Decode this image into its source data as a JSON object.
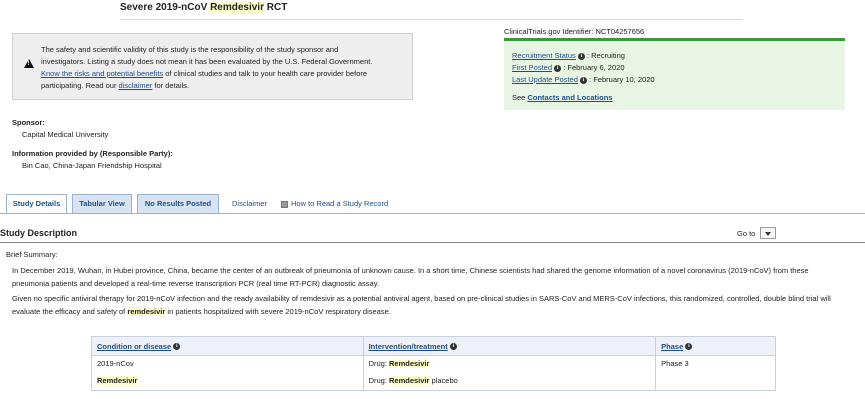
{
  "header": {
    "title_prefix": "Severe 2019-nCoV ",
    "title_highlight": "Remdesivir",
    "title_suffix": " RCT"
  },
  "disclaimer_box": {
    "line1": "The safety and scientific validity of this study is the responsibility of the study sponsor and",
    "line2": "investigators. Listing a study does not mean it has been evaluated by the U.S. Federal Government.",
    "link_risks": "Know the risks and potential benefits",
    "line3_suffix": " of clinical studies and talk to your health care provider before",
    "line4_prefix": "participating. Read our ",
    "link_disclaimer": "disclaimer",
    "line4_suffix": " for details."
  },
  "study_info": {
    "identifier_label": "ClinicalTrials.gov Identifier:",
    "identifier_value": "NCT04257656",
    "recruitment_label": "Recruitment Status",
    "recruitment_value": "Recruiting",
    "first_posted_label": "First Posted",
    "first_posted_value": "February 6, 2020",
    "last_update_label": "Last Update Posted",
    "last_update_value": "February 10, 2020",
    "see_text": "See",
    "contacts_link": "Contacts and Locations"
  },
  "sponsor": {
    "label": "Sponsor:",
    "value": "Capital Medical University"
  },
  "responsible": {
    "label": "Information provided by (Responsible Party):",
    "value": "Bin Cao, China-Japan Friendship Hospital"
  },
  "tabs": {
    "study_details": "Study Details",
    "tabular_view": "Tabular View",
    "no_results": "No Results Posted",
    "disclaimer": "Disclaimer",
    "how_to_read": "How to Read a Study Record"
  },
  "study_description": {
    "heading": "Study Description",
    "goto_label": "Go to",
    "brief_summary_label": "Brief Summary:",
    "p1_line1": "In December 2019, Wuhan, in Hubei province, China, became the center of an outbreak of pneumonia of unknown cause. In a short time, Chinese scientists had shared the genome information of a novel coronavirus (2019-nCoV) from these",
    "p1_line2": "pneumonia patients and developed a real-time reverse transcription PCR (real time RT-PCR) diagnostic assay.",
    "p2_line1": "Given no specific antiviral therapy for 2019-nCoV infection and the ready availability of remdesivir as a potential antiviral agent, based on pre-clinical studies in SARS-CoV and MERS-CoV infections, this randomized, controlled, double blind trial will",
    "p2_line2_prefix": "evaluate the efficacy and safety of ",
    "p2_line2_highlight": "remdesivir",
    "p2_line2_suffix": " in patients hospitalized with severe 2019-nCoV respiratory disease."
  },
  "conditions_table": {
    "headers": [
      "Condition or disease",
      "Intervention/treatment",
      "Phase"
    ],
    "condition_1": "2019-nCov",
    "condition_2": "Remdesivir",
    "intervention_prefix": "Drug: ",
    "intervention_1": "Remdesivir",
    "intervention_2_highlight": "Remdesivir",
    "intervention_2_suffix": " placebo",
    "phase": "Phase 3"
  }
}
